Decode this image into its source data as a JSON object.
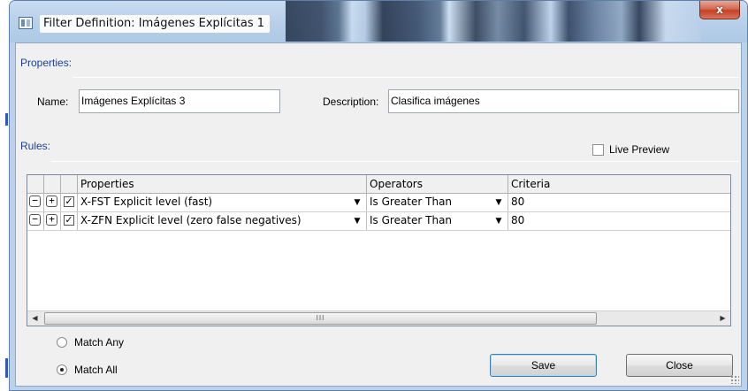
{
  "window": {
    "title": "Filter Definition: Imágenes Explícitas 1",
    "close_glyph": "x"
  },
  "properties_section": {
    "label": "Properties:"
  },
  "name_field": {
    "label": "Name:",
    "value": "Imágenes Explícitas 3"
  },
  "description_field": {
    "label": "Description:",
    "value": "Clasifica imágenes"
  },
  "rules_section": {
    "label": "Rules:"
  },
  "live_preview": {
    "label": "Live Preview",
    "checked": false
  },
  "grid": {
    "columns": [
      "Properties",
      "Operators",
      "Criteria"
    ],
    "rows": [
      {
        "minus": "−",
        "plus": "+",
        "check": "✓",
        "property": "X-FST Explicit level (fast)",
        "operator": "Is Greater Than",
        "criteria": "80"
      },
      {
        "minus": "−",
        "plus": "+",
        "check": "✓",
        "property": "X-ZFN Explicit level (zero false negatives)",
        "operator": "Is Greater Than",
        "criteria": "80"
      }
    ],
    "scrollbar": {
      "left_arrow": "◀",
      "right_arrow": "▶",
      "thumb_grip": "III"
    }
  },
  "match_options": [
    {
      "label": "Match Any",
      "checked": false
    },
    {
      "label": "Match All",
      "checked": true
    }
  ],
  "buttons": {
    "save": "Save",
    "close": "Close"
  }
}
